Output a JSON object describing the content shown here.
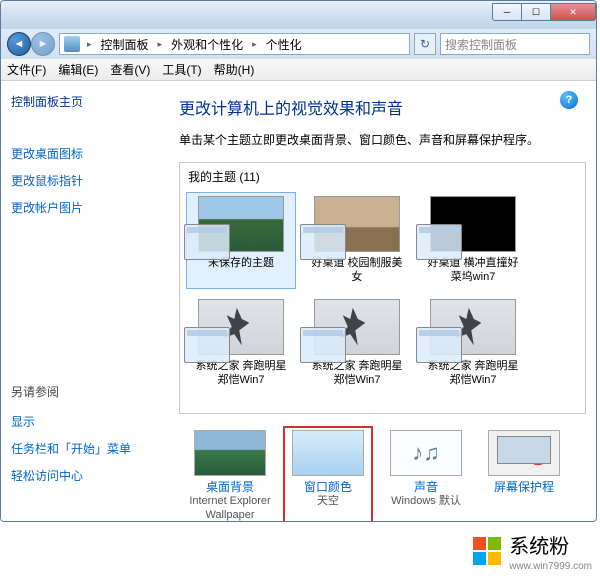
{
  "window": {
    "breadcrumbs": [
      "控制面板",
      "外观和个性化",
      "个性化"
    ],
    "search_placeholder": "搜索控制面板"
  },
  "menu": {
    "file": "文件(F)",
    "edit": "编辑(E)",
    "view": "查看(V)",
    "tools": "工具(T)",
    "help": "帮助(H)"
  },
  "sidebar": {
    "home": "控制面板主页",
    "links": [
      "更改桌面图标",
      "更改鼠标指针",
      "更改帐户图片"
    ],
    "see_also_title": "另请参阅",
    "see_also": [
      "显示",
      "任务栏和「开始」菜单",
      "轻松访问中心"
    ]
  },
  "main": {
    "title": "更改计算机上的视觉效果和声音",
    "subtitle": "单击某个主题立即更改桌面背景、窗口颜色、声音和屏幕保护程序。",
    "themes_header": "我的主题 (11)",
    "themes": [
      {
        "label": "未保存的主题",
        "thumb": "nature",
        "selected": true
      },
      {
        "label": "好桌道 校园制服美女",
        "thumb": "school"
      },
      {
        "label": "好桌道 横冲直撞好菜坞win7",
        "thumb": "dark"
      },
      {
        "label": "系统之家 奔跑明星郑恺Win7",
        "thumb": "runner"
      },
      {
        "label": "系统之家 奔跑明星郑恺Win7",
        "thumb": "runner"
      },
      {
        "label": "系统之家 奔跑明星郑恺Win7",
        "thumb": "runner"
      }
    ],
    "bottom": [
      {
        "label1": "桌面背景",
        "label2": "Internet Explorer Wallpaper",
        "thumb": "bg",
        "highlighted": false
      },
      {
        "label1": "窗口颜色",
        "label2": "天空",
        "thumb": "color",
        "highlighted": true
      },
      {
        "label1": "声音",
        "label2": "Windows 默认",
        "thumb": "sound",
        "highlighted": false
      },
      {
        "label1": "屏幕保护程",
        "label2": "",
        "thumb": "screensaver",
        "highlighted": false
      }
    ]
  },
  "footer": {
    "brand": "系统粉",
    "url": "www.win7999.com"
  }
}
